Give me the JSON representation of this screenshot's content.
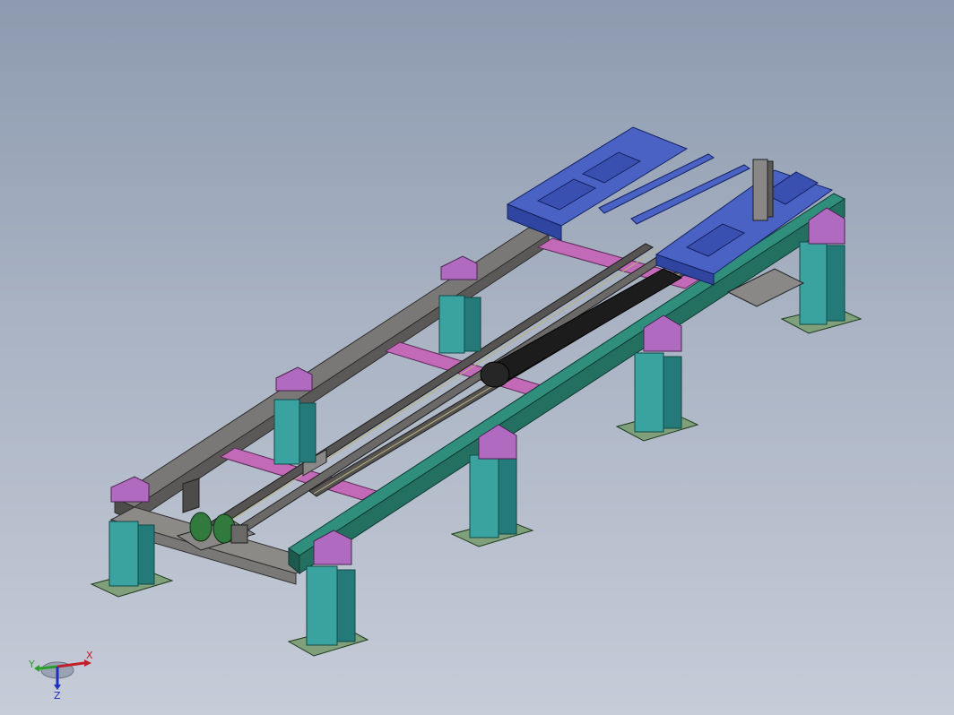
{
  "viewport": {
    "model": {
      "colors": {
        "background_top": "#8d9aaf",
        "background_bottom": "#c6ccd8",
        "column": "#3aa3a0",
        "column_dark": "#237a78",
        "bracket": "#b06ac0",
        "gray_frame": "#6b6a68",
        "gray_frame_dark": "#3f3e3c",
        "green_rail": "#2f8f7c",
        "green_rail_dark": "#1d6354",
        "pink_cross": "#c26ab8",
        "blue_carriage": "#3e55b5",
        "blue_carriage_dark": "#243a8a",
        "base_plate": "#7fa07a",
        "motor_green": "#2f7a3c",
        "cable_chain": "#1c1c1c"
      }
    }
  },
  "triad": {
    "x_label": "X",
    "y_label": "Y",
    "z_label": "Z",
    "x_color": "#c0202a",
    "y_color": "#2aa02a",
    "z_color": "#2030c0"
  }
}
